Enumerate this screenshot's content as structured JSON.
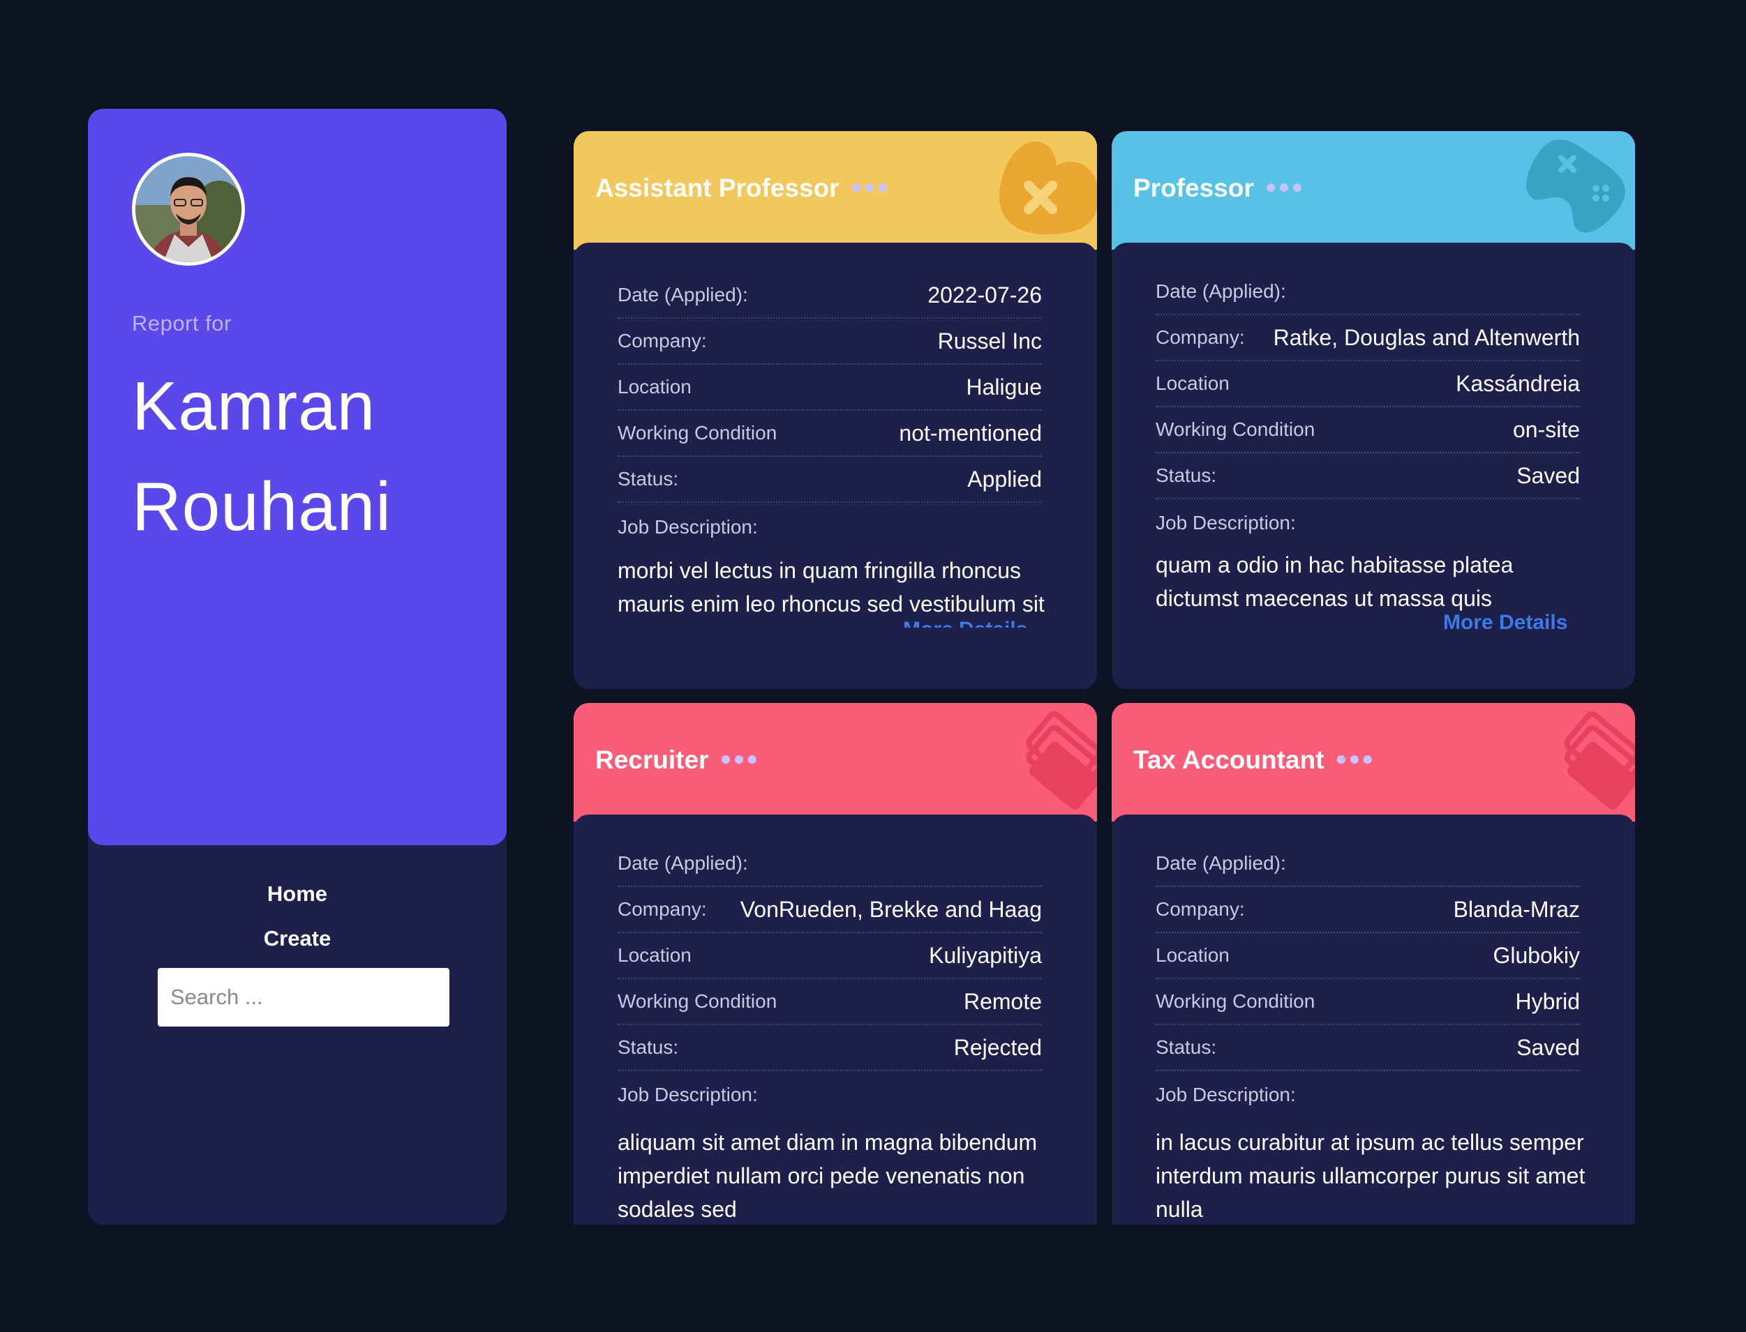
{
  "profile": {
    "report_for": "Report for",
    "first_name": "Kamran",
    "last_name": "Rouhani",
    "card_color": "#5a48ea"
  },
  "nav": {
    "home": "Home",
    "create": "Create"
  },
  "search": {
    "placeholder": "Search ..."
  },
  "labels": {
    "date": "Date (Applied):",
    "company": "Company:",
    "location": "Location",
    "working_condition": "Working Condition",
    "status": "Status:",
    "job_description": "Job Description:",
    "more_details": "More Details"
  },
  "jobs": [
    {
      "title": "Assistant Professor",
      "header_color": "#f2c85c",
      "icon": "heart-x-icon",
      "date": "2022-07-26",
      "company": "Russel Inc",
      "location": "Haligue",
      "working_condition": "not-mentioned",
      "status": "Applied",
      "description": "morbi vel lectus in quam fringilla rhoncus mauris enim leo rhoncus sed vestibulum sit"
    },
    {
      "title": "Professor",
      "header_color": "#58c2e6",
      "icon": "gamepad-icon",
      "date": "",
      "company": "Ratke, Douglas and Altenwerth",
      "location": "Kassándreia",
      "working_condition": "on-site",
      "status": "Saved",
      "description": "quam a odio in hac habitasse platea dictumst maecenas ut massa quis"
    },
    {
      "title": "Recruiter",
      "header_color": "#fb5d79",
      "icon": "tickets-icon",
      "date": "",
      "company": "VonRueden, Brekke and Haag",
      "location": "Kuliyapitiya",
      "working_condition": "Remote",
      "status": "Rejected",
      "description": "aliquam sit amet diam in magna bibendum imperdiet nullam orci pede venenatis non sodales sed"
    },
    {
      "title": "Tax Accountant",
      "header_color": "#fb5d79",
      "icon": "tickets-icon",
      "date": "",
      "company": "Blanda-Mraz",
      "location": "Glubokiy",
      "working_condition": "Hybrid",
      "status": "Saved",
      "description": "in lacus curabitur at ipsum ac tellus semper interdum mauris ullamcorper purus sit amet nulla"
    }
  ]
}
